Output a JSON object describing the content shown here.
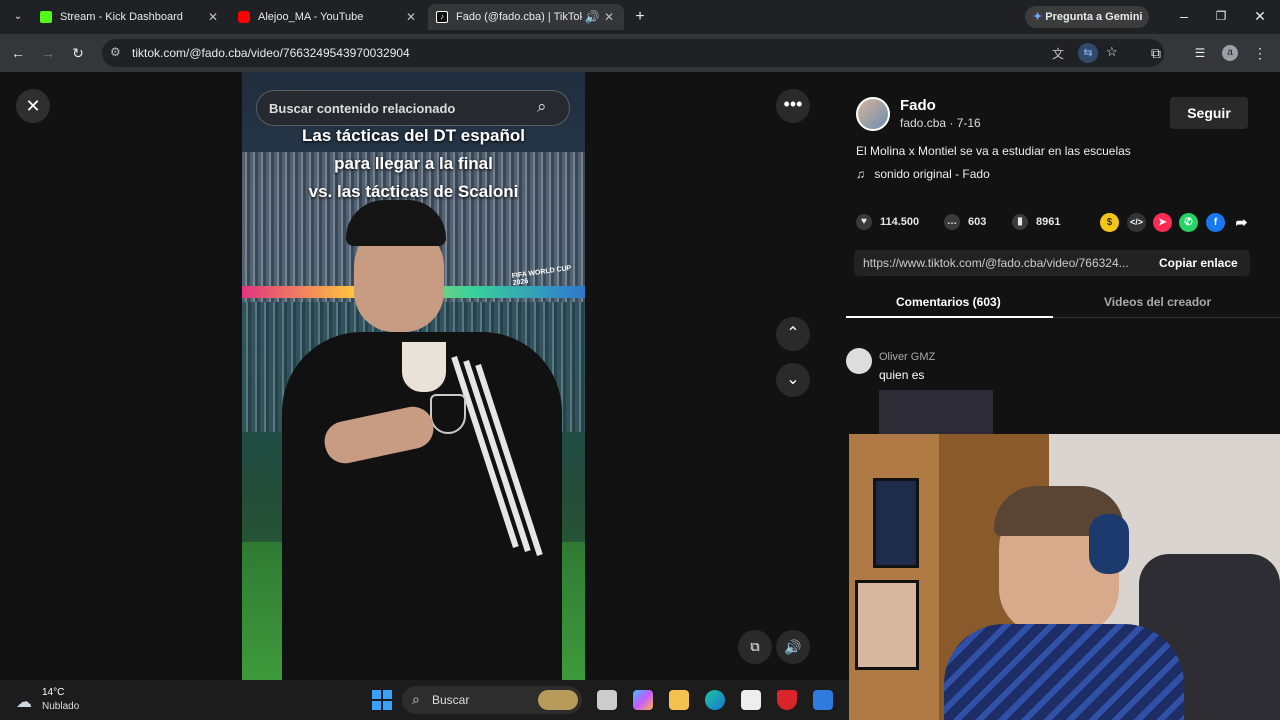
{
  "browser": {
    "tabs": [
      {
        "label": "Stream - Kick Dashboard",
        "favicon": "kick-icon",
        "color": "#53fc18",
        "active": false
      },
      {
        "label": "Alejoo_MA - YouTube",
        "favicon": "youtube-icon",
        "color": "#ff0000",
        "active": false
      },
      {
        "label": "Fado (@fado.cba) | TikTok",
        "favicon": "tiktok-icon",
        "color": "#ffffff",
        "active": true
      }
    ],
    "gemini_label": "Pregunta a Gemini",
    "url": "tiktok.com/@fado.cba/video/7663249543970032904",
    "profile_initial": "a"
  },
  "video": {
    "search_placeholder": "Buscar contenido relacionado",
    "caption_lines": [
      "Las tácticas del DT español",
      "para llegar a la final",
      "vs. las tácticas de Scaloni"
    ],
    "banner_text": "FIFA WORLD CUP 2026"
  },
  "creator": {
    "name": "Fado",
    "handle_date": "fado.cba · 7-16",
    "follow_label": "Seguir",
    "description": "El Molina x Montiel se va a estudiar en las escuelas",
    "sound": "sonido original - Fado"
  },
  "stats": {
    "likes": "114.500",
    "comments": "603",
    "saves": "8961"
  },
  "share": {
    "link": "https://www.tiktok.com/@fado.cba/video/766324...",
    "copy_label": "Copiar enlace"
  },
  "tabs": {
    "comments": "Comentarios (603)",
    "creator_videos": "Videos del creador"
  },
  "comments": [
    {
      "user": "Oliver GMZ",
      "text": "quien es"
    }
  ],
  "taskbar": {
    "temperature": "14°C",
    "weather": "Nublado",
    "search_label": "Buscar"
  }
}
